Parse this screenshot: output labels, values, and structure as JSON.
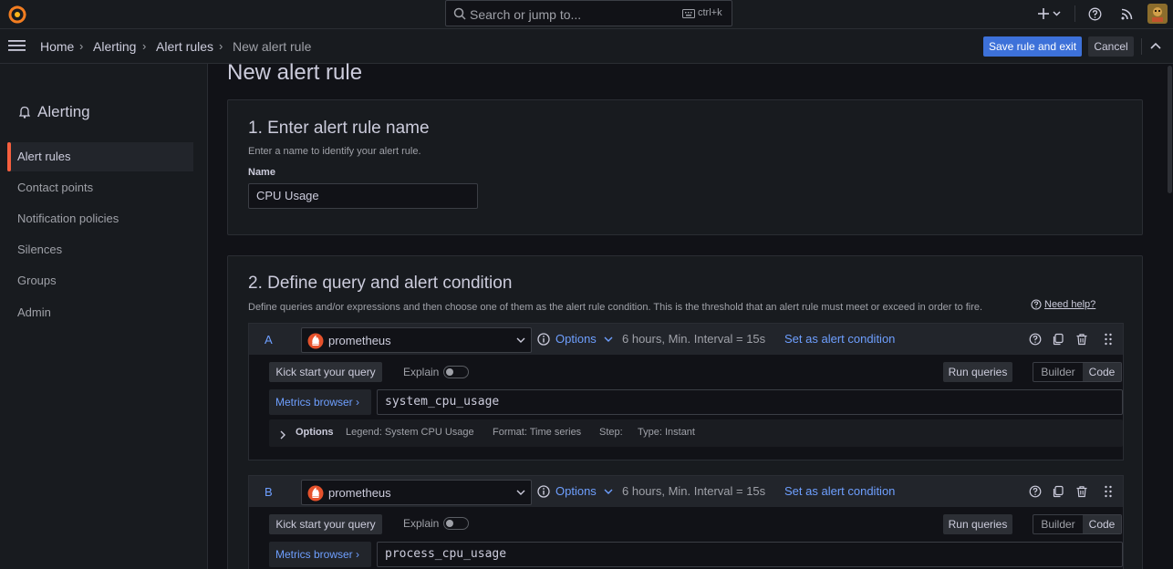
{
  "topbar": {
    "search_placeholder": "Search or jump to...",
    "shortcut": "ctrl+k",
    "add_icon": "plus-icon",
    "help_icon": "help-icon",
    "news_icon": "rss-icon"
  },
  "breadcrumbs": [
    "Home",
    "Alerting",
    "Alert rules",
    "New alert rule"
  ],
  "actions": {
    "save": "Save rule and exit",
    "cancel": "Cancel"
  },
  "sidebar": {
    "title": "Alerting",
    "items": [
      {
        "label": "Alert rules",
        "active": true
      },
      {
        "label": "Contact points",
        "active": false
      },
      {
        "label": "Notification policies",
        "active": false
      },
      {
        "label": "Silences",
        "active": false
      },
      {
        "label": "Groups",
        "active": false
      },
      {
        "label": "Admin",
        "active": false
      }
    ]
  },
  "page": {
    "title": "New alert rule"
  },
  "section1": {
    "title": "1. Enter alert rule name",
    "description": "Enter a name to identify your alert rule.",
    "name_label": "Name",
    "name_value": "CPU Usage"
  },
  "section2": {
    "title": "2. Define query and alert condition",
    "description": "Define queries and/or expressions and then choose one of them as the alert rule condition. This is the threshold that an alert rule must meet or exceed in order to fire.",
    "help_link": "Need help?"
  },
  "queries": [
    {
      "letter": "A",
      "datasource": "prometheus",
      "options_label": "Options",
      "options_info": "6 hours, Min. Interval = 15s",
      "set_condition": "Set as alert condition",
      "kick_start": "Kick start your query",
      "explain": "Explain",
      "run": "Run queries",
      "builder": "Builder",
      "code": "Code",
      "metrics_browser": "Metrics browser",
      "expr": "system_cpu_usage",
      "options_row": {
        "title": "Options",
        "legend": "Legend: System CPU Usage",
        "format": "Format: Time series",
        "step": "Step:",
        "type": "Type: Instant"
      }
    },
    {
      "letter": "B",
      "datasource": "prometheus",
      "options_label": "Options",
      "options_info": "6 hours, Min. Interval = 15s",
      "set_condition": "Set as alert condition",
      "kick_start": "Kick start your query",
      "explain": "Explain",
      "run": "Run queries",
      "builder": "Builder",
      "code": "Code",
      "metrics_browser": "Metrics browser",
      "expr": "process_cpu_usage"
    }
  ],
  "colors": {
    "primary": "#3d71d9",
    "link": "#6e9fff",
    "accent": "#f55f3e",
    "background": "#111217",
    "panel": "#181b1f"
  }
}
